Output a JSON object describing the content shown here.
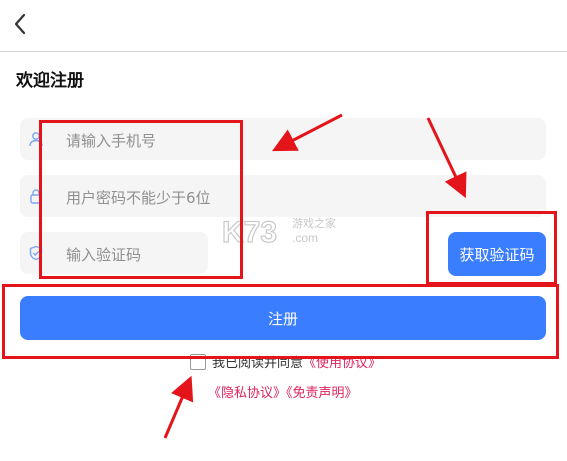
{
  "header": {
    "back_icon": "chevron-left-icon"
  },
  "page": {
    "title": "欢迎注册"
  },
  "form": {
    "phone_placeholder": "请输入手机号",
    "password_placeholder": "用户密码不能少于6位",
    "code_placeholder": "输入验证码",
    "get_code_label": "获取验证码",
    "register_label": "注册"
  },
  "agreement": {
    "prefix": "我已阅读并同意",
    "terms_link": "《使用协议》",
    "privacy_link": "《隐私协议》",
    "disclaimer_link": "《免责声明》"
  },
  "watermark": {
    "brand": "K73",
    "cn": "游戏之家",
    "domain": ".com"
  },
  "colors": {
    "accent": "#3a7dff",
    "annotation_red": "#e4141b",
    "link": "#e0245e",
    "field_bg": "#f5f5f5"
  }
}
